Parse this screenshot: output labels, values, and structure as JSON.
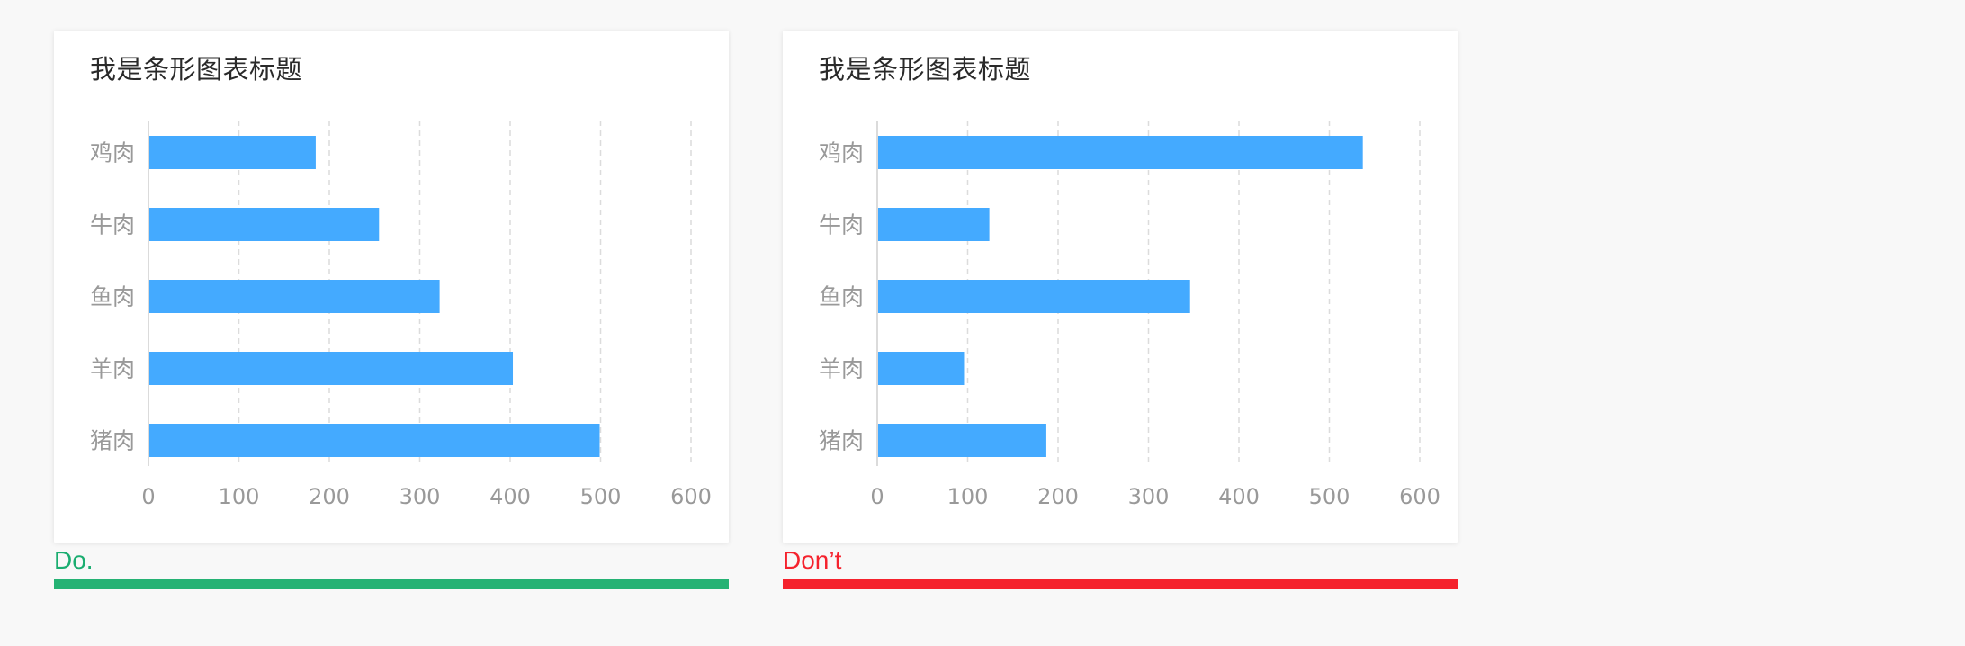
{
  "colors": {
    "bar": "#44aaff",
    "grid": "#dcdcdc",
    "axis": "#cfcfcf",
    "tick_text": "#999999",
    "do": "#25b274",
    "dont": "#f5222d"
  },
  "verdicts": {
    "do_label": "Do.",
    "dont_label": "Don’t"
  },
  "chart_data": [
    {
      "type": "bar",
      "orientation": "horizontal",
      "title": "我是条形图表标题",
      "categories": [
        "鸡肉",
        "牛肉",
        "鱼肉",
        "羊肉",
        "猪肉"
      ],
      "values": [
        185,
        255,
        322,
        403,
        499
      ],
      "xlim": [
        0,
        600
      ],
      "xticks": [
        0,
        100,
        200,
        300,
        400,
        500,
        600
      ],
      "grid": "vertical-dashed",
      "xlabel": "",
      "ylabel": ""
    },
    {
      "type": "bar",
      "orientation": "horizontal",
      "title": "我是条形图表标题",
      "categories": [
        "鸡肉",
        "牛肉",
        "鱼肉",
        "羊肉",
        "猪肉"
      ],
      "values": [
        537,
        124,
        346,
        96,
        187
      ],
      "xlim": [
        0,
        600
      ],
      "xticks": [
        0,
        100,
        200,
        300,
        400,
        500,
        600
      ],
      "grid": "vertical-dashed",
      "xlabel": "",
      "ylabel": ""
    }
  ]
}
